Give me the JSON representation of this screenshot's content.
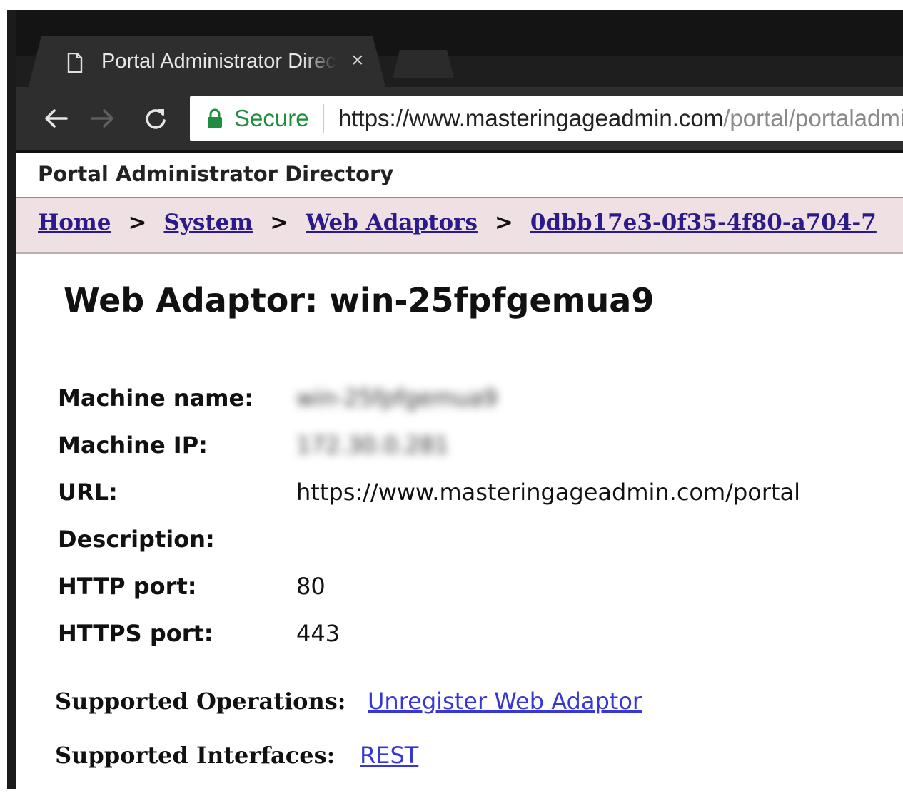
{
  "browser": {
    "tab": {
      "title": "Portal Administrator Directory",
      "close_glyph": "×",
      "icon": "document-icon"
    },
    "nav": {
      "back_icon": "back-arrow-icon",
      "forward_icon": "forward-arrow-icon",
      "reload_icon": "reload-icon"
    },
    "address": {
      "secure_label": "Secure",
      "url_host": "https://www.masteringageadmin.com",
      "url_path": "/portal/portaladmin",
      "lock_color": "#1e8e3e"
    }
  },
  "page": {
    "header": "Portal Administrator Directory",
    "breadcrumb": {
      "items": [
        "Home",
        "System",
        "Web Adaptors",
        "0dbb17e3-0f35-4f80-a704-7"
      ],
      "separator": ">"
    },
    "title": "Web Adaptor: win-25fpfgemua9",
    "properties": [
      {
        "label": "Machine name:",
        "value": "win-25fpfgemua9",
        "blurred": true
      },
      {
        "label": "Machine IP:",
        "value": "172.30.0.281",
        "blurred": true
      },
      {
        "label": "URL:",
        "value": "https://www.masteringageadmin.com/portal",
        "blurred": false
      },
      {
        "label": "Description:",
        "value": "",
        "blurred": false
      },
      {
        "label": "HTTP port:",
        "value": "80",
        "blurred": false
      },
      {
        "label": "HTTPS port:",
        "value": "443",
        "blurred": false
      }
    ],
    "operations": {
      "label": "Supported Operations:",
      "link": "Unregister Web Adaptor"
    },
    "interfaces": {
      "label": "Supported Interfaces:",
      "link": "REST"
    },
    "colors": {
      "link": "#3737d6",
      "breadcrumb_link": "#2a1a8a",
      "breadcrumb_bg": "#efe1e3"
    }
  }
}
